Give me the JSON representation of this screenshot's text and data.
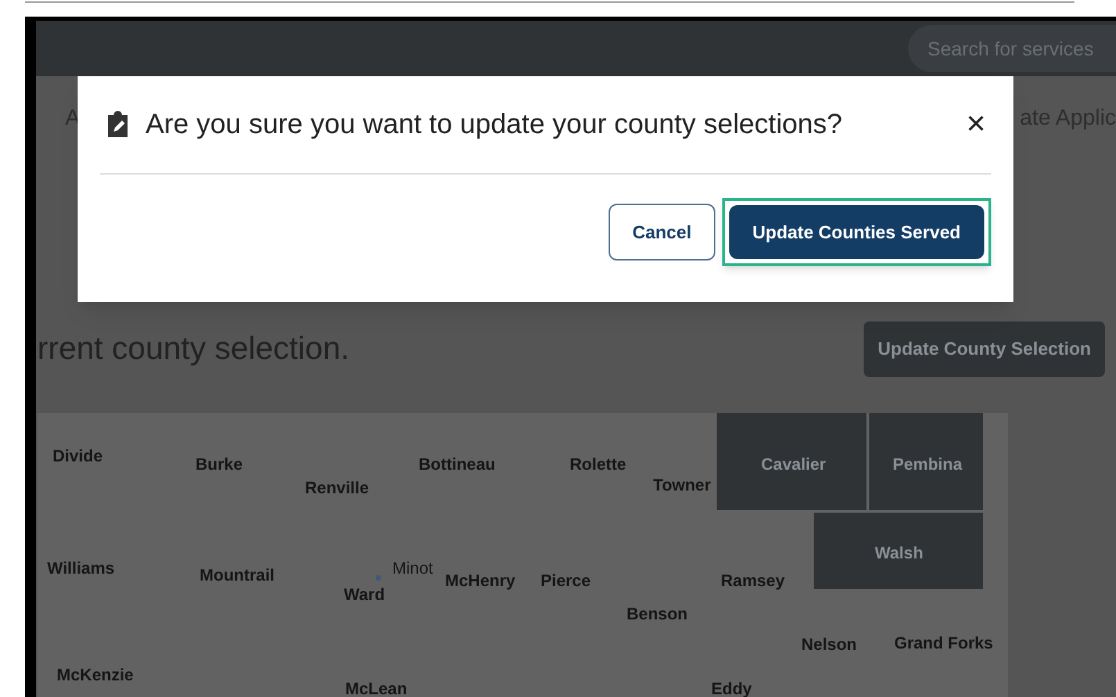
{
  "header": {
    "search": {
      "placeholder": "Search for services"
    }
  },
  "page": {
    "left_fragment": "A",
    "right_fragment": "ate Applic",
    "heading": "rrent county selection.",
    "update_button": "Update County Selection"
  },
  "map": {
    "counties": [
      {
        "name": "Divide",
        "selected": false
      },
      {
        "name": "Burke",
        "selected": false
      },
      {
        "name": "Renville",
        "selected": false
      },
      {
        "name": "Bottineau",
        "selected": false
      },
      {
        "name": "Rolette",
        "selected": false
      },
      {
        "name": "Towner",
        "selected": false
      },
      {
        "name": "Cavalier",
        "selected": true
      },
      {
        "name": "Pembina",
        "selected": true
      },
      {
        "name": "Williams",
        "selected": false
      },
      {
        "name": "Mountrail",
        "selected": false
      },
      {
        "name": "Ward",
        "selected": false
      },
      {
        "name": "McHenry",
        "selected": false
      },
      {
        "name": "Pierce",
        "selected": false
      },
      {
        "name": "Benson",
        "selected": false
      },
      {
        "name": "Ramsey",
        "selected": false
      },
      {
        "name": "Walsh",
        "selected": true
      },
      {
        "name": "Nelson",
        "selected": false
      },
      {
        "name": "Grand Forks",
        "selected": false
      },
      {
        "name": "McKenzie",
        "selected": false
      },
      {
        "name": "McLean",
        "selected": false
      },
      {
        "name": "Eddy",
        "selected": false
      }
    ],
    "cities": [
      {
        "name": "Minot"
      }
    ]
  },
  "dialog": {
    "title": "Are you sure you want to update your county selections?",
    "close": "×",
    "buttons": [
      {
        "label": "Cancel",
        "kind": "secondary",
        "focused": false
      },
      {
        "label": "Update Counties Served",
        "kind": "primary",
        "focused": true
      }
    ]
  }
}
